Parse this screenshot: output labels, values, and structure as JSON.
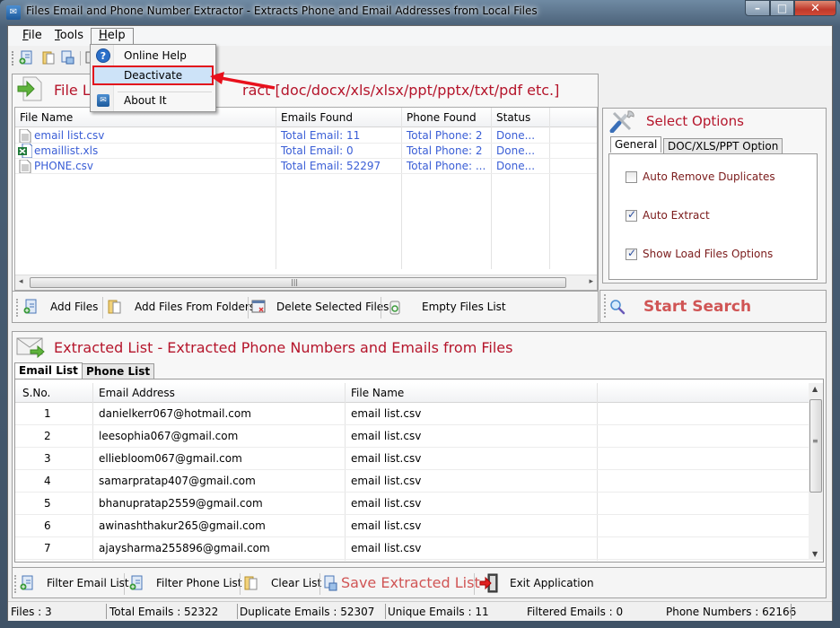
{
  "window": {
    "title": "Files Email and Phone Number Extractor  -  Extracts Phone and Email Addresses from Local Files",
    "minimize_label": "–",
    "maximize_label": "□",
    "close_label": "✕"
  },
  "menubar": {
    "items": [
      {
        "label": "File",
        "mnemonic": "F",
        "rest": "ile"
      },
      {
        "label": "Tools",
        "mnemonic": "T",
        "rest": "ools"
      },
      {
        "label": "Help",
        "mnemonic": "H",
        "rest": "elp"
      }
    ]
  },
  "help_menu": {
    "items": [
      {
        "label": "Online Help",
        "icon": "help-icon"
      },
      {
        "label": "Deactivate",
        "highlighted": true
      },
      {
        "label": "About It",
        "icon": "mail-icon"
      }
    ]
  },
  "file_list_panel": {
    "title_visible_left": "File L",
    "title_visible_right": "ract  [doc/docx/xls/xlsx/ppt/pptx/txt/pdf etc.]",
    "columns": [
      "File Name",
      "Emails Found",
      "Phone Found",
      "Status"
    ],
    "rows": [
      {
        "file": "email list.csv",
        "icon": "text-file-icon",
        "emails": "Total Email: 11",
        "phones": "Total Phone: 2",
        "status": "Done..."
      },
      {
        "file": "emaillist.xls",
        "icon": "excel-file-icon",
        "emails": "Total Email: 0",
        "phones": "Total Phone: 2",
        "status": "Done..."
      },
      {
        "file": "PHONE.csv",
        "icon": "text-file-icon",
        "emails": "Total Email: 52297",
        "phones": "Total Phone: ...",
        "status": "Done..."
      }
    ],
    "buttons": {
      "add_files": "Add Files",
      "add_folders": "Add Files From Folders",
      "delete_selected": "Delete Selected Files",
      "empty_list": "Empty Files List"
    }
  },
  "options_panel": {
    "title": "Select Options",
    "tabs": [
      "General",
      "DOC/XLS/PPT Option"
    ],
    "active_tab": "General",
    "checkboxes": [
      {
        "label": "Auto Remove Duplicates",
        "checked": false
      },
      {
        "label": "Auto Extract",
        "checked": true
      },
      {
        "label": "Show Load Files Options",
        "checked": true
      }
    ],
    "start_search": "Start Search"
  },
  "extracted_panel": {
    "title": "Extracted List - Extracted Phone Numbers and Emails from Files",
    "tabs": [
      "Email List",
      "Phone List"
    ],
    "active_tab": "Email List",
    "columns": [
      "S.No.",
      "Email Address",
      "File Name"
    ],
    "rows": [
      {
        "sno": "1",
        "email": "danielkerr067@hotmail.com",
        "file": "email list.csv"
      },
      {
        "sno": "2",
        "email": "leesophia067@gmail.com",
        "file": "email list.csv"
      },
      {
        "sno": "3",
        "email": "elliebloom067@gmail.com",
        "file": "email list.csv"
      },
      {
        "sno": "4",
        "email": "samarpratap407@gmail.com",
        "file": "email list.csv"
      },
      {
        "sno": "5",
        "email": "bhanupratap2559@gmail.com",
        "file": "email list.csv"
      },
      {
        "sno": "6",
        "email": "awinashthakur265@gmail.com",
        "file": "email list.csv"
      },
      {
        "sno": "7",
        "email": "ajaysharma255896@gmail.com",
        "file": "email list.csv"
      }
    ],
    "buttons": {
      "filter_email": "Filter Email List",
      "filter_phone": "Filter Phone List",
      "clear": "Clear List",
      "save": "Save Extracted List",
      "exit": "Exit Application"
    }
  },
  "statusbar": {
    "files": "Files :  3",
    "total_emails": "Total Emails :  52322",
    "duplicate_emails": "Duplicate Emails :  52307",
    "unique_emails": "Unique Emails :  11",
    "filtered_emails": "Filtered Emails :  0",
    "phone_numbers": "Phone Numbers :  62166"
  },
  "colors": {
    "accent_red": "#b5152b",
    "link_blue": "#3a5ed6",
    "highlight_border": "#e2101c"
  }
}
